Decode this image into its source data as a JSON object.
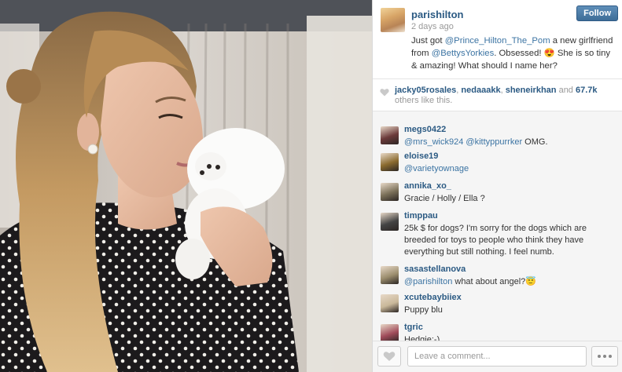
{
  "post": {
    "username": "parishilton",
    "timestamp": "2 days ago",
    "follow_label": "Follow",
    "caption": {
      "t1": "Just got ",
      "m1": "@Prince_Hilton_The_Pom",
      "t2": " a new girlfriend from ",
      "m2": "@BettysYorkies",
      "t3": ". Obsessed! 😍 She is so tiny & amazing! What should I name her?"
    }
  },
  "likes": {
    "users": [
      "jacky05rosales",
      "nedaaakk",
      "sheneirkhan"
    ],
    "sep": ", ",
    "and_text": " and ",
    "count": "67.7k",
    "suffix": " others like this."
  },
  "comments": [
    {
      "user": "megs0422",
      "parts": [
        {
          "m": "@mrs_wick924"
        },
        {
          "t": " "
        },
        {
          "m": "@kittyppurrker"
        },
        {
          "t": " OMG."
        }
      ],
      "avatar_color": "#6b3a3a"
    },
    {
      "user": "eloise19",
      "parts": [
        {
          "m": "@varietyownage"
        }
      ],
      "avatar_color": "#8a6a2f"
    },
    {
      "user": "annika_xo_",
      "parts": [
        {
          "t": "Gracie / Holly / Ella ?"
        }
      ],
      "avatar_color": "#7a6f58"
    },
    {
      "user": "timppau",
      "parts": [
        {
          "t": "25k $ for dogs? I'm sorry for the dogs which are breeded for toys to people who think they have everything but still nothing. I feel numb."
        }
      ],
      "avatar_color": "#444444"
    },
    {
      "user": "sasastellanova",
      "parts": [
        {
          "m": "@parishilton"
        },
        {
          "t": " what about angel?😇"
        }
      ],
      "avatar_color": "#9a8c6c"
    },
    {
      "user": "xcutebaybiiex",
      "parts": [
        {
          "t": "Puppy blu"
        }
      ],
      "avatar_color": "#c9b89a"
    },
    {
      "user": "tgric",
      "parts": [
        {
          "t": "Hedgie:-)"
        }
      ],
      "avatar_color": "#a04b5a"
    }
  ],
  "footer": {
    "comment_placeholder": "Leave a comment..."
  },
  "icons": {
    "likes_heart": "heart-icon",
    "like_button": "heart-outline-icon",
    "more_button": "more-dots-icon"
  },
  "colors": {
    "username": "#2b5a83",
    "mention": "#3c74a3",
    "follow_button": "#3e6d98",
    "comments_bg": "#f5f5f5"
  }
}
